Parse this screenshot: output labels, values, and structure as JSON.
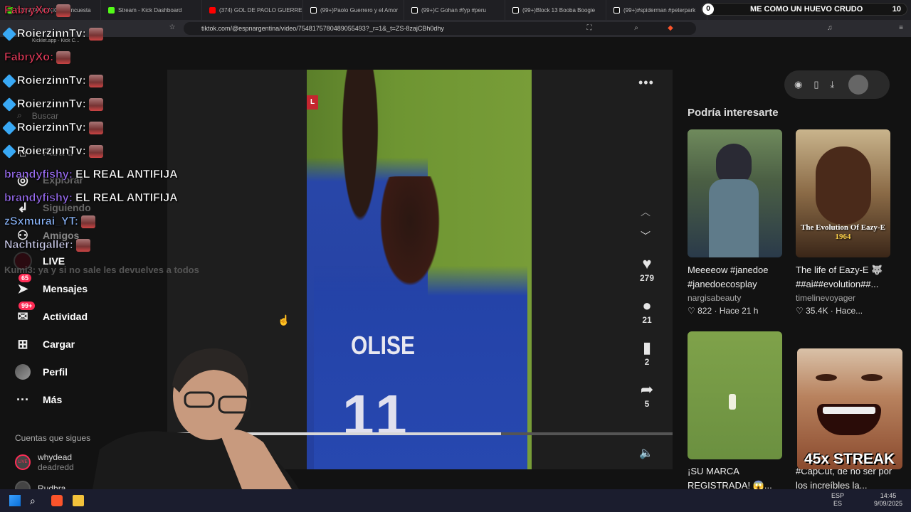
{
  "browser": {
    "tabs": [
      {
        "label": "TIENDA DE KICK - Encuesta",
        "color": "#53fc18"
      },
      {
        "label": "Stream - Kick Dashboard",
        "color": "#53fc18"
      },
      {
        "label": "(374) GOL DE PAOLO GUERRERO",
        "color": "#ff0000"
      },
      {
        "label": "(99+)Paolo Guerrero y el Amor",
        "color": "#ffffff"
      },
      {
        "label": "(99+)C Gohan #fyp #peru",
        "color": "#ffffff"
      },
      {
        "label": "(99+)Block 13 Booba Boogie",
        "color": "#ffffff"
      },
      {
        "label": "(99+)#spiderman #peterpark",
        "color": "#ffffff"
      }
    ],
    "url": "tiktok.com/@espnargentina/video/7548175780489055493?_r=1&_t=ZS-8zajCBh0dhy",
    "bookmark_label": "Kicklet.app - Kick C..."
  },
  "stream_title": {
    "count_left": "0",
    "title": "ME COMO UN HUEVO CRUDO",
    "count_right": "10"
  },
  "sidebar": {
    "search_placeholder": "Buscar",
    "items": [
      {
        "label": "Para ti",
        "icon": "home-icon"
      },
      {
        "label": "Explorar",
        "icon": "compass-icon"
      },
      {
        "label": "Siguiendo",
        "icon": "following-icon"
      },
      {
        "label": "Amigos",
        "icon": "friends-icon"
      },
      {
        "label": "LIVE",
        "icon": "live-icon"
      },
      {
        "label": "Mensajes",
        "icon": "messages-icon",
        "badge": "65"
      },
      {
        "label": "Actividad",
        "icon": "activity-icon",
        "badge": "99+"
      },
      {
        "label": "Cargar",
        "icon": "upload-icon"
      },
      {
        "label": "Perfil",
        "icon": "profile-icon"
      },
      {
        "label": "Más",
        "icon": "more-icon"
      }
    ],
    "following_header": "Cuentas que sigues",
    "following": [
      {
        "name": "whydead",
        "sub": "deadredd",
        "badge": "LIVE"
      },
      {
        "name": "Rudhra",
        "sub": ""
      }
    ]
  },
  "video": {
    "jersey_name": "OLISE",
    "jersey_number": "11",
    "corner_tag": "L",
    "progress": 0.66,
    "likes": "279",
    "comments": "21",
    "saves": "2",
    "shares": "5"
  },
  "recommendations": {
    "header": "Podría interesarte",
    "items": [
      {
        "title": "Meeeeow #janedoe #janedoecosplay",
        "author": "nargisabeauty",
        "stats": "♡ 822 · Hace 21 h"
      },
      {
        "title": "The life of Eazy-E 🐺 ##ai##evolution##...",
        "author": "timelinevoyager",
        "stats": "♡ 35.4K · Hace...",
        "thumb_caption": "The Evolution Of Eazy-E",
        "thumb_year": "1964"
      },
      {
        "title": "¡SU MARCA REGISTRADA! 😱...",
        "author": "",
        "stats": ""
      },
      {
        "title": "#CapCut, de no ser por los increíbles la...",
        "author": "",
        "stats": ""
      }
    ]
  },
  "chat": [
    {
      "user": "FabryXo:",
      "color": "#e03b5a",
      "text": "",
      "emote": true
    },
    {
      "user": "RoierzinnTv:",
      "color": "#ffffff",
      "text": "",
      "emote": true,
      "badges": true
    },
    {
      "user": "FabryXo:",
      "color": "#e03b5a",
      "text": "",
      "emote": true
    },
    {
      "user": "RoierzinnTv:",
      "color": "#ffffff",
      "text": "",
      "emote": true,
      "badges": true
    },
    {
      "user": "RoierzinnTv:",
      "color": "#ffffff",
      "text": "",
      "emote": true,
      "badges": true
    },
    {
      "user": "RoierzinnTv:",
      "color": "#ffffff",
      "text": "",
      "emote": true,
      "badges": true
    },
    {
      "user": "RoierzinnTv:",
      "color": "#ffffff",
      "text": "",
      "emote": true,
      "badges": true
    },
    {
      "user": "brandyfishy:",
      "color": "#9b6ef3",
      "text": "EL REAL ANTIFIJA"
    },
    {
      "user": "brandyfishy:",
      "color": "#9b6ef3",
      "text": "EL REAL ANTIFIJA"
    },
    {
      "user": "zSxmurai_YT:",
      "color": "#8ab4f8",
      "text": "",
      "emote": true
    },
    {
      "user": "Nachtigaller:",
      "color": "#c9c9e8",
      "text": "",
      "emote": true
    }
  ],
  "chat_faded": "Kumi3: ya y si no sale les devuelves a todos",
  "streak_label": "45x STREAK",
  "taskbar": {
    "lang": "ESP",
    "lang2": "ES",
    "time": "14:45",
    "date": "9/09/2025"
  }
}
